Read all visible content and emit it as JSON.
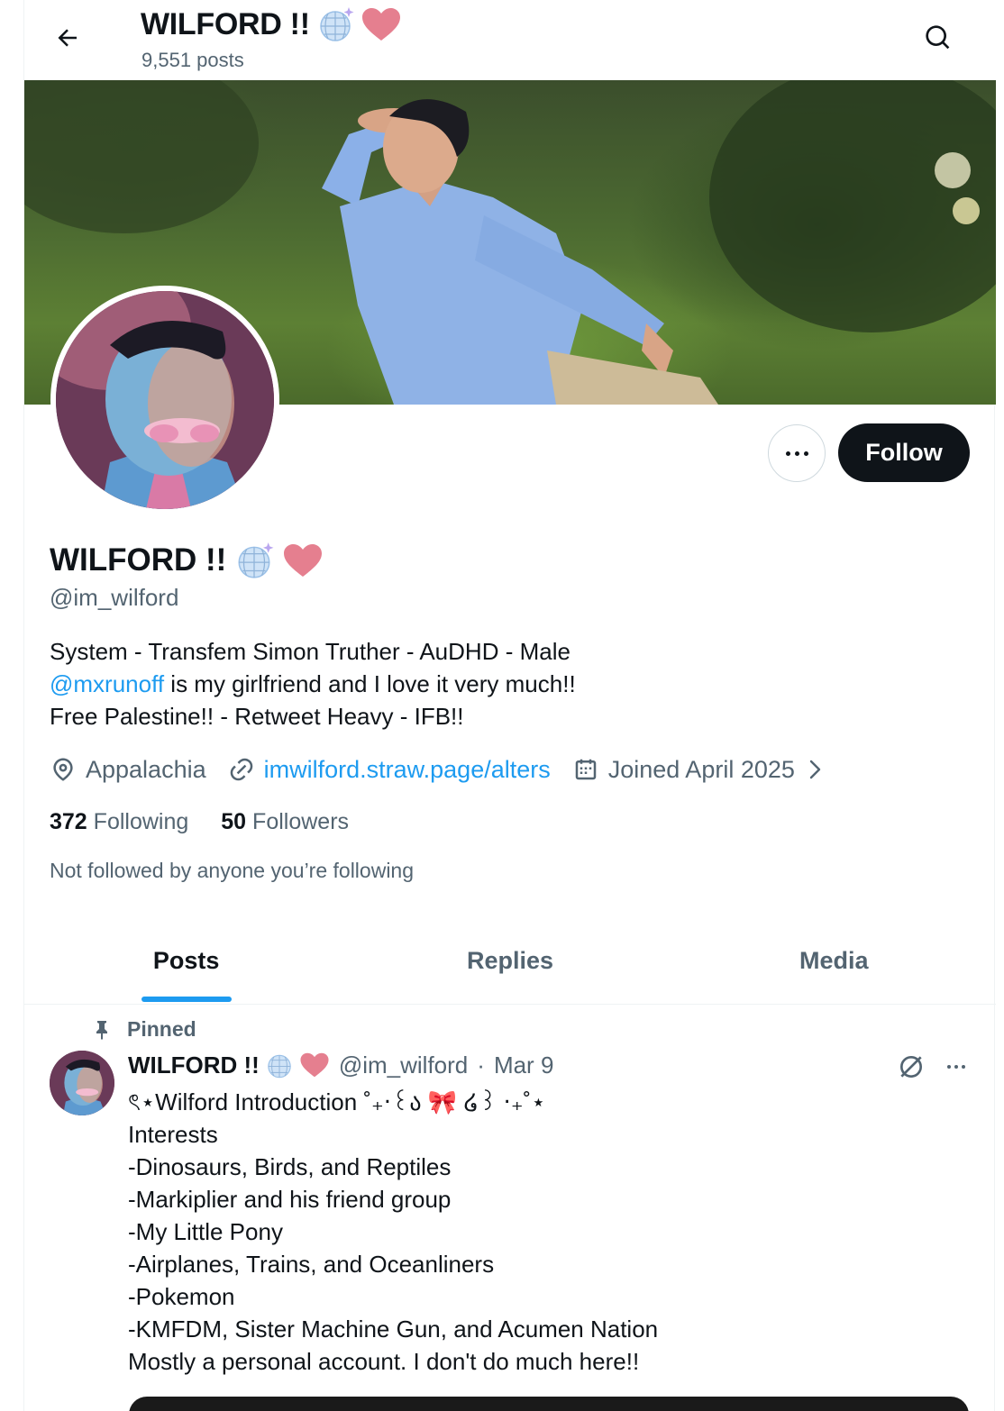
{
  "header": {
    "title": "WILFORD !!",
    "post_count": "9,551 posts"
  },
  "profile": {
    "name": "WILFORD !!",
    "handle": "@im_wilford",
    "follow_label": "Follow",
    "bio_line1": "System - Transfem Simon Truther - AuDHD - Male",
    "bio_mention": "@mxrunoff",
    "bio_line2_rest": " is my girlfriend and I love it very much!!",
    "bio_line3": "Free Palestine!! - Retweet Heavy - IFB!!",
    "location": "Appalachia",
    "website": "imwilford.straw.page/alters",
    "joined": "Joined April 2025",
    "following_count": "372",
    "following_label": "Following",
    "followers_count": "50",
    "followers_label": "Followers",
    "not_followed": "Not followed by anyone you’re following"
  },
  "tabs": [
    {
      "label": "Posts",
      "active": true
    },
    {
      "label": "Replies",
      "active": false
    },
    {
      "label": "Media",
      "active": false
    }
  ],
  "pinned_post": {
    "pinned_label": "Pinned",
    "name": "WILFORD !!",
    "handle": "@im_wilford",
    "sep": "·",
    "date": "Mar 9",
    "lines": [
      "ৎ⋆Wilford Introduction ˚₊‧꒰ა 🎀 ໒꒱ ‧₊˚⋆",
      "Interests",
      "-Dinosaurs, Birds, and Reptiles",
      "-Markiplier and his friend group",
      "-My Little Pony",
      "-Airplanes, Trains, and Oceanliners",
      "-Pokemon",
      "-KMFDM, Sister Machine Gun, and Acumen Nation",
      "Mostly a personal account. I don't do much here!!"
    ]
  },
  "icons": {
    "back": "arrow-left-icon",
    "search": "search-icon",
    "more": "more-horizontal-icon",
    "location": "location-pin-icon",
    "link": "link-icon",
    "calendar": "calendar-icon",
    "chevron": "chevron-right-icon",
    "pin": "pin-icon",
    "grok": "grok-icon",
    "globe_emoji": "disco-ball-icon",
    "heart_emoji": "heart-icon"
  },
  "colors": {
    "accent": "#1d9bf0",
    "text": "#0f1419",
    "muted": "#536471",
    "heart": "#e57f8f",
    "follow_bg": "#0f1419"
  }
}
